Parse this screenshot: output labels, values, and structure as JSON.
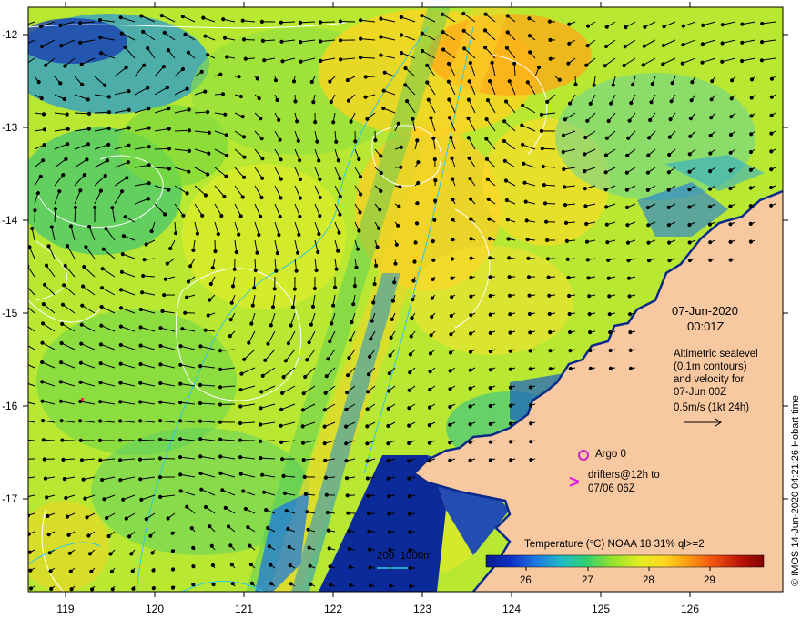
{
  "map": {
    "colors": {
      "land": "#f8c9a0",
      "sea_base": "#b8e832",
      "contour": "#ffffff",
      "bathymetry": "#30c8e0",
      "argo": "#cc22cc",
      "drifter": "#e020e0",
      "arrow": "#000000"
    },
    "axes": {
      "lon_ticks": [
        "119",
        "120",
        "121",
        "122",
        "123",
        "124",
        "125",
        "126"
      ],
      "lat_ticks": [
        "-12",
        "-13",
        "-14",
        "-15",
        "-16",
        "-17"
      ],
      "lon_range": [
        118.6,
        126.9
      ],
      "lat_range": [
        -11.75,
        -18.0
      ]
    },
    "title": {
      "date": "07-Jun-2020",
      "time": "00:01Z"
    },
    "altimetry_note": [
      "Altimetric sealevel",
      "(0.1m contours)",
      "and velocity for",
      "07-Jun 00Z",
      "0.5m/s (1kt 24h)"
    ],
    "argo_label": "Argo 0",
    "drifters_label": [
      "drifters@12h to",
      "07/06 06Z"
    ],
    "depth_legend": "200  1000m",
    "colorbar": {
      "title": "Temperature (°C) NOAA 18 31% ql>=2",
      "ticks": [
        "26",
        "27",
        "28",
        "29"
      ],
      "range": [
        25.2,
        29.9
      ],
      "stops": [
        "#0a1a8c",
        "#1030c8",
        "#1e78e0",
        "#20b8c8",
        "#30d070",
        "#90e030",
        "#e0ee20",
        "#ffd820",
        "#ff9a10",
        "#f05010",
        "#c01808",
        "#800000"
      ]
    },
    "credit": "© IMOS 14-Jun-2020 04:21:26 Hobart time"
  }
}
